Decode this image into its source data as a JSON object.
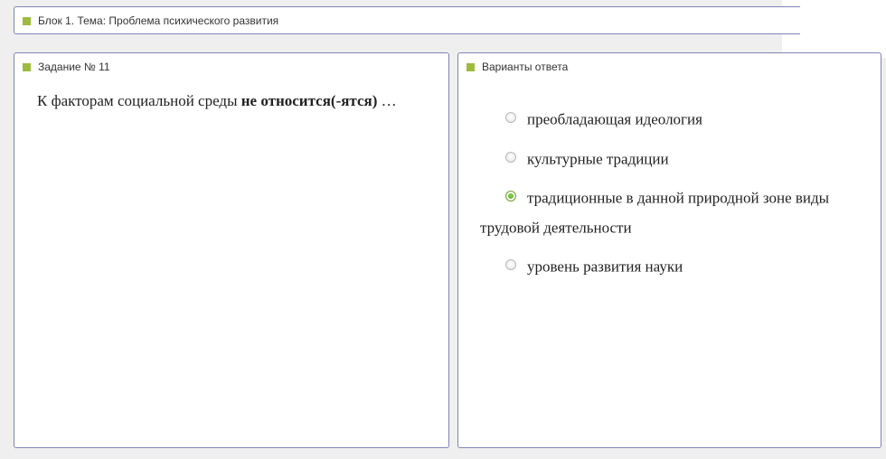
{
  "topic": {
    "title": "Блок 1. Тема: Проблема психического развития"
  },
  "task": {
    "title": "Задание № 11",
    "question_prefix": "К факторам социальной среды ",
    "question_emphasis": "не относится(-ятся)",
    "question_suffix": " …"
  },
  "answers": {
    "title": "Варианты ответа",
    "options": [
      {
        "label": "преобладающая идеология"
      },
      {
        "label": "культурные традиции"
      },
      {
        "label": "традиционные в данной природной зоне виды трудовой деятельности"
      },
      {
        "label": "уровень развития науки"
      }
    ],
    "selected_index": 2
  },
  "colors": {
    "marker": "#9dbb3d",
    "panel_border": "#7f84b6",
    "selected_radio": "#5cad24"
  },
  "icons": {
    "panel_marker": "green-square-marker-icon",
    "radio": "radio-button-icon"
  }
}
